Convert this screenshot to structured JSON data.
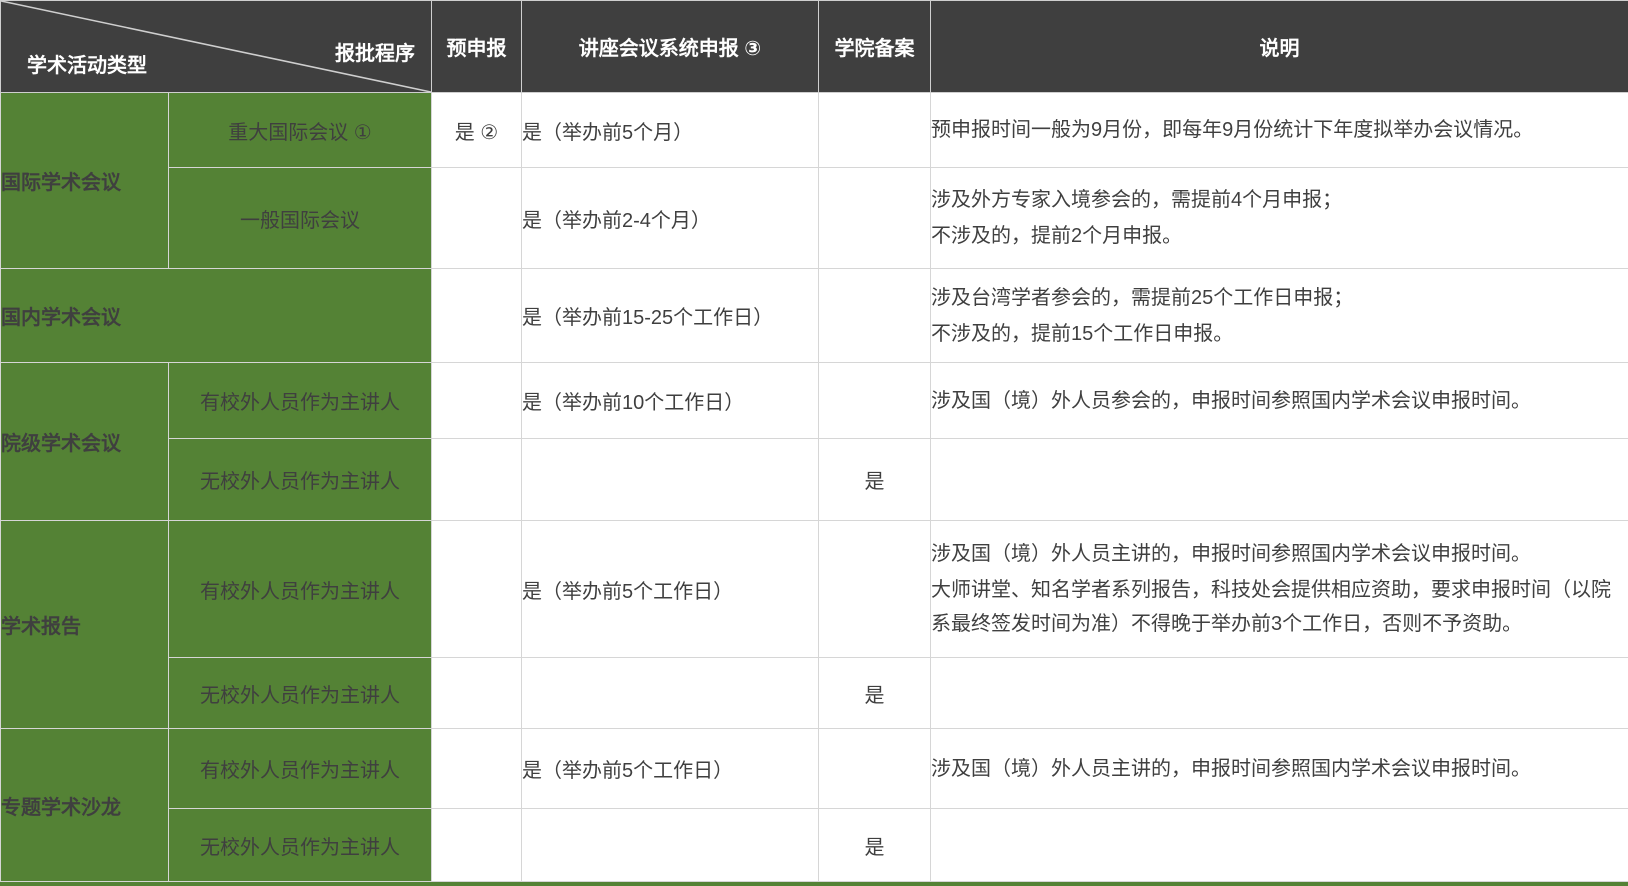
{
  "colors": {
    "green": "#548235",
    "header_dark": "#3f3f3f",
    "grid_line": "#d6d6d6",
    "body_text": "#3f3f3f",
    "header_text": "#ffffff"
  },
  "table": {
    "header": {
      "corner_top": "报批程序",
      "corner_bottom": "学术活动类型",
      "col_pre": "预申报",
      "col_sys": "讲座会议系统申报 ③",
      "col_filing": "学院备案",
      "col_note": "说明"
    },
    "rows": [
      {
        "category": "国际学术会议",
        "sub": "重大国际会议 ①",
        "pre": "是 ②",
        "sys": "是（举办前5个月）",
        "filing": "",
        "note_lines": [
          "预申报时间一般为9月份，即每年9月份统计下年度拟举办会议情况。"
        ]
      },
      {
        "sub": "一般国际会议",
        "pre": "",
        "sys": "是（举办前2-4个月）",
        "filing": "",
        "note_lines": [
          "涉及外方专家入境参会的，需提前4个月申报；",
          "不涉及的，提前2个月申报。"
        ]
      },
      {
        "category": "国内学术会议",
        "pre": "",
        "sys": "是（举办前15-25个工作日）",
        "filing": "",
        "note_lines": [
          "涉及台湾学者参会的，需提前25个工作日申报；",
          "不涉及的，提前15个工作日申报。"
        ]
      },
      {
        "category": "院级学术会议",
        "sub": "有校外人员作为主讲人",
        "pre": "",
        "sys": "是（举办前10个工作日）",
        "filing": "",
        "note_lines": [
          "涉及国（境）外人员参会的，申报时间参照国内学术会议申报时间。"
        ]
      },
      {
        "sub": "无校外人员作为主讲人",
        "pre": "",
        "sys": "",
        "filing": "是",
        "note_lines": []
      },
      {
        "category": "学术报告",
        "sub": "有校外人员作为主讲人",
        "pre": "",
        "sys": "是（举办前5个工作日）",
        "filing": "",
        "note_lines": [
          "涉及国（境）外人员主讲的，申报时间参照国内学术会议申报时间。",
          "大师讲堂、知名学者系列报告，科技处会提供相应资助，要求申报时间（以院系最终签发时间为准）不得晚于举办前3个工作日，否则不予资助。"
        ]
      },
      {
        "sub": "无校外人员作为主讲人",
        "pre": "",
        "sys": "",
        "filing": "是",
        "note_lines": []
      },
      {
        "category": "专题学术沙龙",
        "sub": "有校外人员作为主讲人",
        "pre": "",
        "sys": "是（举办前5个工作日）",
        "filing": "",
        "note_lines": [
          "涉及国（境）外人员主讲的，申报时间参照国内学术会议申报时间。"
        ]
      },
      {
        "sub": "无校外人员作为主讲人",
        "pre": "",
        "sys": "",
        "filing": "是",
        "note_lines": []
      }
    ]
  }
}
